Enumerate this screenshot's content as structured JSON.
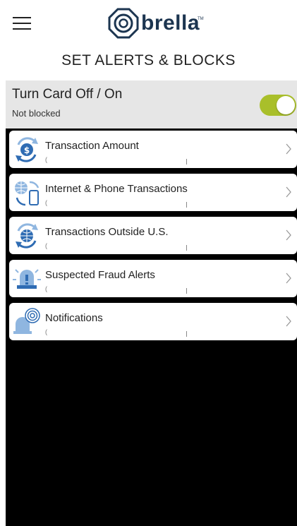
{
  "header": {
    "menu_icon": "hamburger-menu-icon",
    "logo_text": "brella",
    "logo_tm": "TM"
  },
  "page_title": "SET ALERTS & BLOCKS",
  "card_toggle": {
    "title": "Turn Card Off / On",
    "status": "Not blocked",
    "enabled": true,
    "accent_color": "#a9bf2a"
  },
  "items": [
    {
      "label": "Transaction Amount",
      "sub": "(",
      "icon": "dollar-refresh-icon"
    },
    {
      "label": "Internet & Phone Transactions",
      "sub": "(",
      "icon": "globe-phone-icon"
    },
    {
      "label": "Transactions Outside U.S.",
      "sub": "(",
      "icon": "globe-refresh-icon"
    },
    {
      "label": "Suspected Fraud Alerts",
      "sub": "(",
      "icon": "siren-alert-icon"
    },
    {
      "label": "Notifications",
      "sub": "(",
      "icon": "bell-icon"
    }
  ],
  "colors": {
    "icon_blue": "#2f6cb3",
    "icon_light_blue": "#8fb6e0",
    "brand_navy": "#1c3550"
  }
}
